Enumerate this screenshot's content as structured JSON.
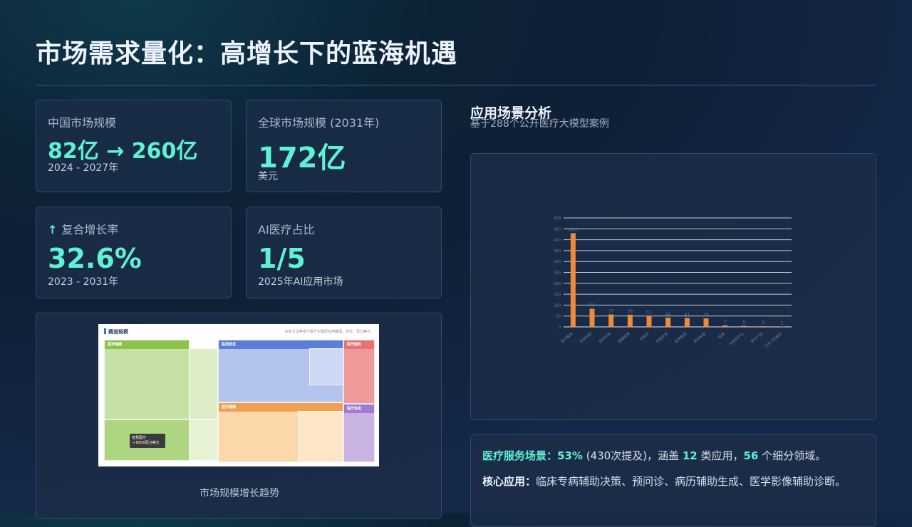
{
  "page": {
    "title": "市场需求量化：高增长下的蓝海机遇"
  },
  "stats": [
    {
      "label": "中国市场规模",
      "value": "82亿 → 260亿",
      "sub": "2024 - 2027年"
    },
    {
      "label": "全球市场规模 (2031年)",
      "value": "172亿",
      "sub": "美元"
    },
    {
      "label": "复合增长率",
      "icon": "arrow-up-icon",
      "icon_glyph": "↑",
      "value": "32.6%",
      "sub": "2023 - 2031年"
    },
    {
      "label": "AI医疗占比",
      "value": "1/5",
      "sub": "2025年AI应用市场"
    }
  ],
  "treemap": {
    "title": "赛道规模",
    "note": "由东方证券基于医疗大模型应用整理，单位：百万美元",
    "caption": "市场规模增长趋势",
    "groups": [
      {
        "name": "医学健康",
        "color": "#8bc34a"
      },
      {
        "name": "医药研发",
        "color": "#5b7fd6"
      },
      {
        "name": "医疗服务",
        "color": "#e57373"
      },
      {
        "name": "医疗器械",
        "color": "#f0a050"
      },
      {
        "name": "医疗信息",
        "color": "#a17bd0"
      }
    ],
    "tooltip": {
      "name": "智慧医疗",
      "value": "→ 8500百万美元"
    }
  },
  "analysis": {
    "title": "应用场景分析",
    "subtitle": "基于288个公开医疗大模型案例"
  },
  "chart_data": {
    "type": "bar",
    "title": "",
    "xlabel": "",
    "ylabel": "",
    "categories": [
      "医疗服务",
      "医学科研",
      "医药研发",
      "健康管理",
      "中医药",
      "药物研发",
      "医学教育",
      "医学影像",
      "医保",
      "中医药产业",
      "医疗产品",
      "公共卫生服务"
    ],
    "values": [
      430,
      83,
      57,
      56,
      51,
      42,
      41,
      39,
      7,
      5,
      3,
      2
    ],
    "ylim": [
      0,
      500
    ],
    "yticks": [
      0,
      50,
      100,
      150,
      200,
      250,
      300,
      350,
      400,
      450,
      500
    ],
    "bar_color": "#f08a3a",
    "grid": true
  },
  "info": {
    "line1_label": "医疗服务场景：",
    "line1_pct": "53%",
    "line1_mid": "(430次提及)，涵盖",
    "line1_n1": "12",
    "line1_mid2": "类应用，",
    "line1_n2": "56",
    "line1_end": "个细分领域。",
    "line2_label": "核心应用：",
    "line2_text": "临床专病辅助决策、预问诊、病历辅助生成、医学影像辅助诊断。"
  }
}
